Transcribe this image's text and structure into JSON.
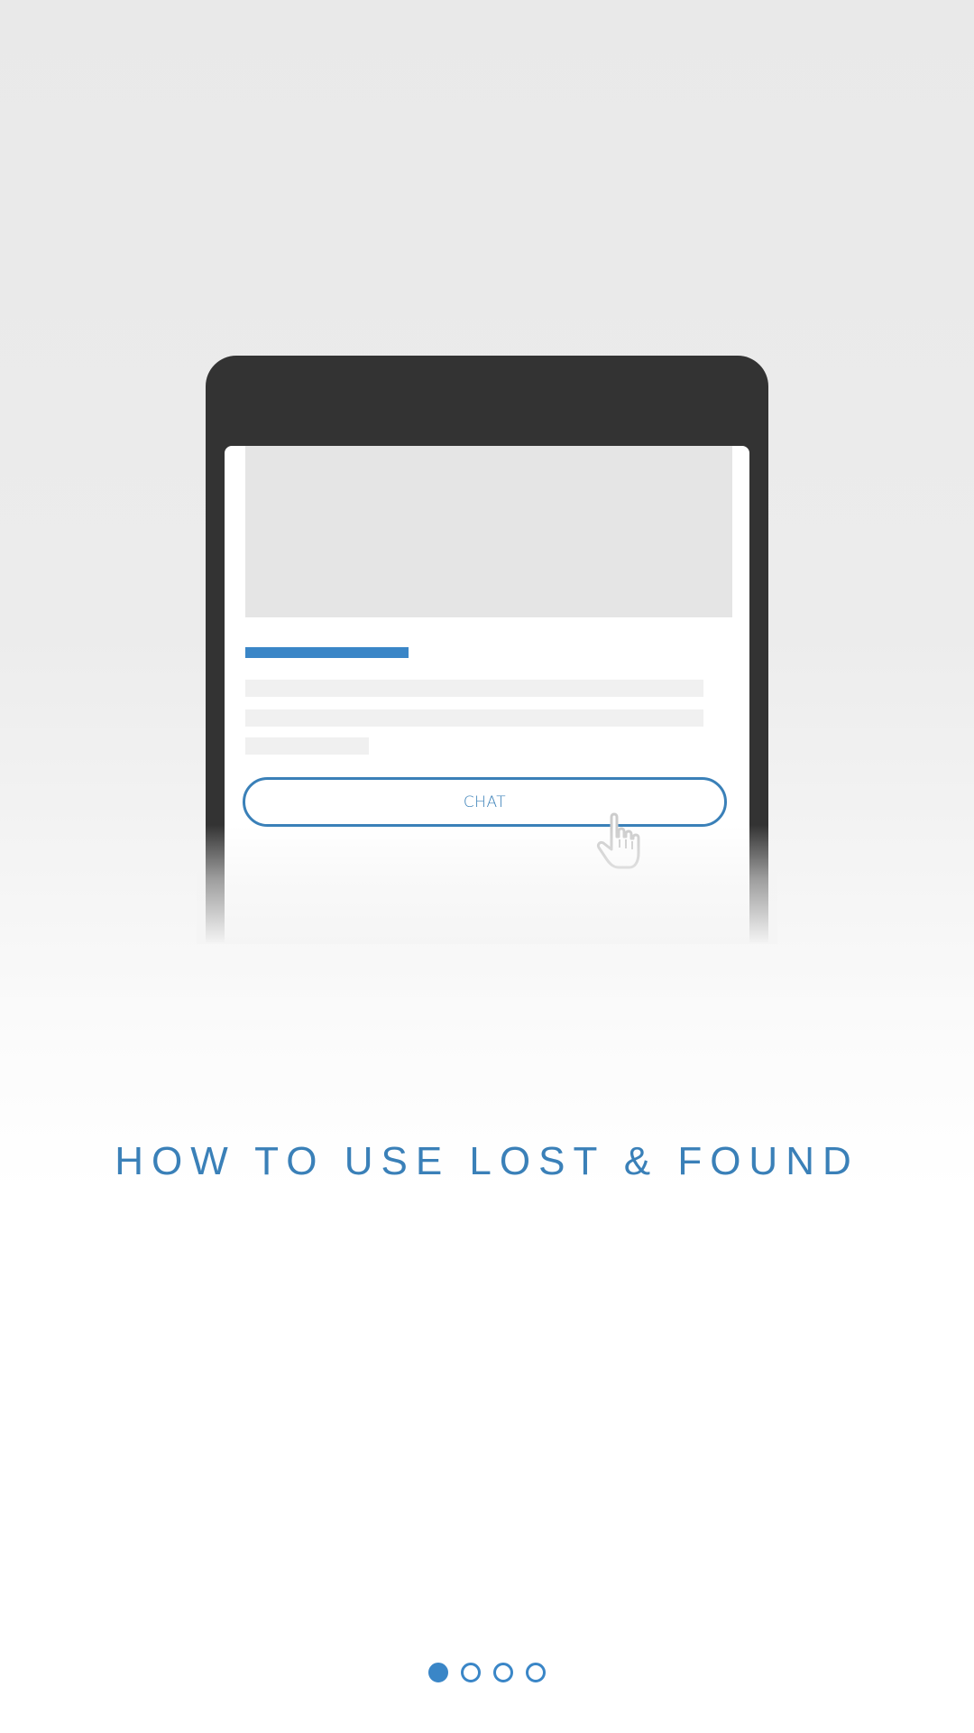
{
  "illustration": {
    "chat_button_label": "CHAT",
    "pointer_icon": "hand-pointer-icon"
  },
  "heading": "HOW TO USE LOST & FOUND",
  "pagination": {
    "total": 4,
    "active_index": 0
  },
  "colors": {
    "accent": "#3a86c7",
    "phone_frame": "#333333",
    "placeholder": "#e5e5e5",
    "pointer": "#c8c8c8"
  }
}
